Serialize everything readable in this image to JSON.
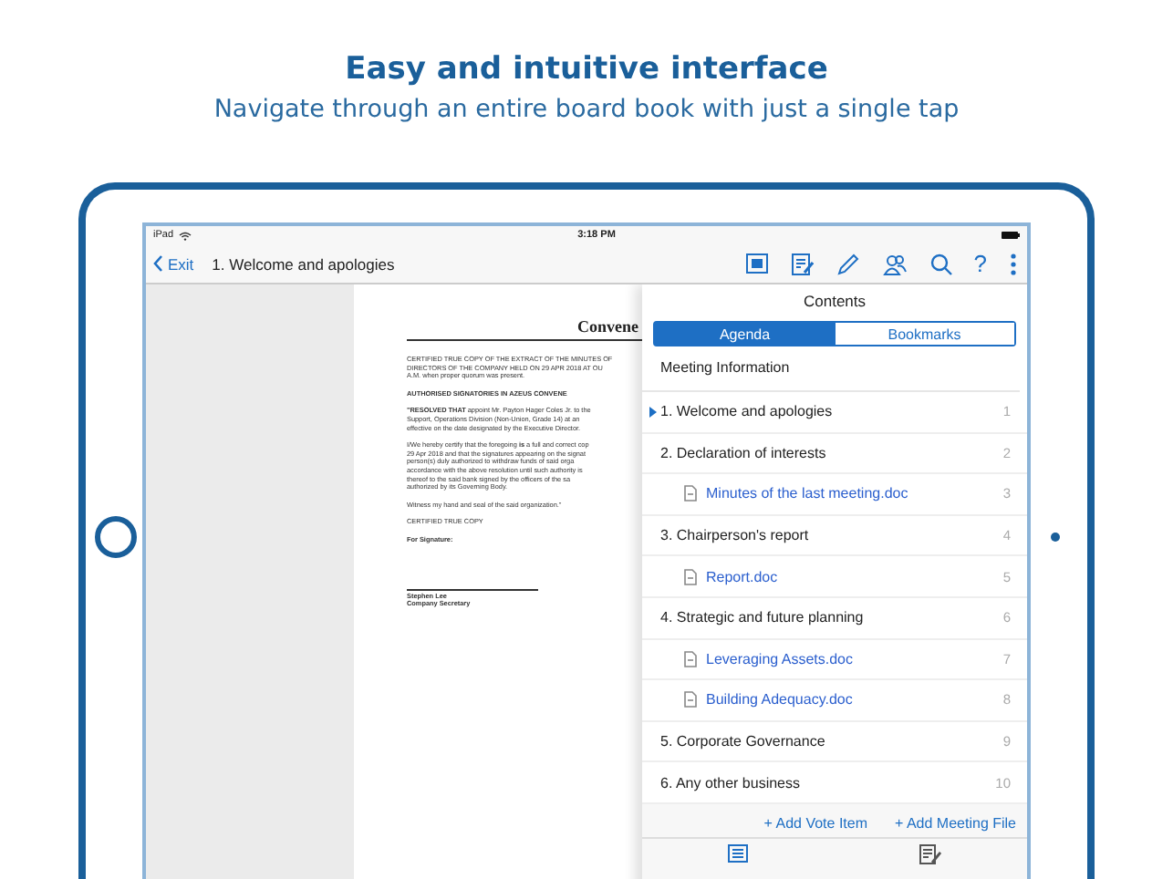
{
  "header": {
    "title": "Easy and intuitive interface",
    "subtitle": "Navigate through an entire board book with just a single tap"
  },
  "status_bar": {
    "device": "iPad",
    "time": "3:18 PM"
  },
  "nav_bar": {
    "back": "Exit",
    "title": "1. Welcome and apologies",
    "help": "?"
  },
  "document": {
    "title": "Convene",
    "blocks": [
      {
        "kind": "text",
        "lines": [
          "CERTIFIED TRUE COPY OF THE EXTRACT OF THE MINUTES OF",
          "DIRECTORS OF THE COMPANY HELD ON 29 APR 2018 AT OU",
          "A.M. when proper quorum was present."
        ]
      },
      {
        "kind": "heading",
        "lines": [
          "AUTHORISED SIGNATORIES IN AZEUS CONVENE"
        ]
      },
      {
        "kind": "text",
        "lines": [
          "**\"RESOLVED THAT** appoint Mr. Payton Hager Coles Jr. to the",
          "Support, Operations Division (Non-Union, Grade 14) at an",
          "effective on the date designated by the Executive Director."
        ]
      },
      {
        "kind": "text",
        "lines": [
          "I/We hereby certify that the foregoing **is** a full and correct cop",
          "29 Apr 2018 and that the signatures appearing on the signat",
          "person(s) duly authorized to withdraw funds of said orga",
          "accordance with the above resolution until such authority is",
          "thereof to the said bank signed by the officers of the sa",
          "authorized by its Governing Body."
        ]
      },
      {
        "kind": "text",
        "lines": [
          "Witness my hand and seal of the said organization.\""
        ]
      },
      {
        "kind": "text",
        "lines": [
          "CERTIFIED TRUE COPY"
        ]
      },
      {
        "kind": "heading",
        "lines": [
          "For Signature:"
        ]
      },
      {
        "kind": "signature",
        "lines": [
          "Stephen Lee",
          "Company Secretary"
        ]
      }
    ]
  },
  "panel": {
    "title": "Contents",
    "tabs": [
      {
        "label": "Agenda",
        "selected": true
      },
      {
        "label": "Bookmarks",
        "selected": false
      }
    ],
    "section": "Meeting Information",
    "items": [
      {
        "kind": "item",
        "label": "1. Welcome and apologies",
        "page": "1",
        "selected": true
      },
      {
        "kind": "item",
        "label": "2. Declaration of interests",
        "page": "2",
        "selected": false
      },
      {
        "kind": "file",
        "label": "Minutes of the last meeting.doc",
        "page": "3",
        "selected": false
      },
      {
        "kind": "item",
        "label": "3. Chairperson's report",
        "page": "4",
        "selected": false
      },
      {
        "kind": "file",
        "label": "Report.doc",
        "page": "5",
        "selected": false
      },
      {
        "kind": "item",
        "label": "4. Strategic and future planning",
        "page": "6",
        "selected": false
      },
      {
        "kind": "file",
        "label": "Leveraging Assets.doc",
        "page": "7",
        "selected": false
      },
      {
        "kind": "file",
        "label": "Building Adequacy.doc",
        "page": "8",
        "selected": false
      },
      {
        "kind": "item",
        "label": "5. Corporate Governance",
        "page": "9",
        "selected": false
      },
      {
        "kind": "item",
        "label": "6. Any other business",
        "page": "10",
        "selected": false
      }
    ],
    "actions": [
      "+ Add Vote Item",
      "+ Add Meeting File"
    ],
    "bottom_tabs": [
      {
        "kind": "contents",
        "selected": true
      },
      {
        "kind": "annotations",
        "selected": false
      }
    ]
  }
}
